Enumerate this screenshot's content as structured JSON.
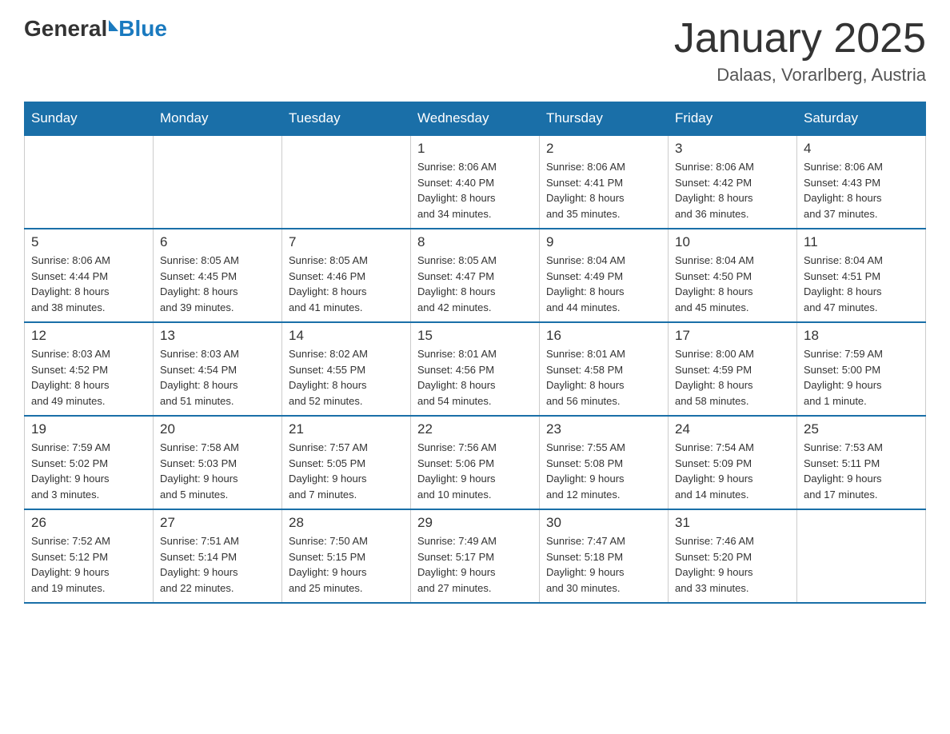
{
  "logo": {
    "general": "General",
    "blue": "Blue"
  },
  "title": "January 2025",
  "location": "Dalaas, Vorarlberg, Austria",
  "days_of_week": [
    "Sunday",
    "Monday",
    "Tuesday",
    "Wednesday",
    "Thursday",
    "Friday",
    "Saturday"
  ],
  "weeks": [
    {
      "days": [
        {
          "number": "",
          "info": ""
        },
        {
          "number": "",
          "info": ""
        },
        {
          "number": "",
          "info": ""
        },
        {
          "number": "1",
          "info": "Sunrise: 8:06 AM\nSunset: 4:40 PM\nDaylight: 8 hours\nand 34 minutes."
        },
        {
          "number": "2",
          "info": "Sunrise: 8:06 AM\nSunset: 4:41 PM\nDaylight: 8 hours\nand 35 minutes."
        },
        {
          "number": "3",
          "info": "Sunrise: 8:06 AM\nSunset: 4:42 PM\nDaylight: 8 hours\nand 36 minutes."
        },
        {
          "number": "4",
          "info": "Sunrise: 8:06 AM\nSunset: 4:43 PM\nDaylight: 8 hours\nand 37 minutes."
        }
      ]
    },
    {
      "days": [
        {
          "number": "5",
          "info": "Sunrise: 8:06 AM\nSunset: 4:44 PM\nDaylight: 8 hours\nand 38 minutes."
        },
        {
          "number": "6",
          "info": "Sunrise: 8:05 AM\nSunset: 4:45 PM\nDaylight: 8 hours\nand 39 minutes."
        },
        {
          "number": "7",
          "info": "Sunrise: 8:05 AM\nSunset: 4:46 PM\nDaylight: 8 hours\nand 41 minutes."
        },
        {
          "number": "8",
          "info": "Sunrise: 8:05 AM\nSunset: 4:47 PM\nDaylight: 8 hours\nand 42 minutes."
        },
        {
          "number": "9",
          "info": "Sunrise: 8:04 AM\nSunset: 4:49 PM\nDaylight: 8 hours\nand 44 minutes."
        },
        {
          "number": "10",
          "info": "Sunrise: 8:04 AM\nSunset: 4:50 PM\nDaylight: 8 hours\nand 45 minutes."
        },
        {
          "number": "11",
          "info": "Sunrise: 8:04 AM\nSunset: 4:51 PM\nDaylight: 8 hours\nand 47 minutes."
        }
      ]
    },
    {
      "days": [
        {
          "number": "12",
          "info": "Sunrise: 8:03 AM\nSunset: 4:52 PM\nDaylight: 8 hours\nand 49 minutes."
        },
        {
          "number": "13",
          "info": "Sunrise: 8:03 AM\nSunset: 4:54 PM\nDaylight: 8 hours\nand 51 minutes."
        },
        {
          "number": "14",
          "info": "Sunrise: 8:02 AM\nSunset: 4:55 PM\nDaylight: 8 hours\nand 52 minutes."
        },
        {
          "number": "15",
          "info": "Sunrise: 8:01 AM\nSunset: 4:56 PM\nDaylight: 8 hours\nand 54 minutes."
        },
        {
          "number": "16",
          "info": "Sunrise: 8:01 AM\nSunset: 4:58 PM\nDaylight: 8 hours\nand 56 minutes."
        },
        {
          "number": "17",
          "info": "Sunrise: 8:00 AM\nSunset: 4:59 PM\nDaylight: 8 hours\nand 58 minutes."
        },
        {
          "number": "18",
          "info": "Sunrise: 7:59 AM\nSunset: 5:00 PM\nDaylight: 9 hours\nand 1 minute."
        }
      ]
    },
    {
      "days": [
        {
          "number": "19",
          "info": "Sunrise: 7:59 AM\nSunset: 5:02 PM\nDaylight: 9 hours\nand 3 minutes."
        },
        {
          "number": "20",
          "info": "Sunrise: 7:58 AM\nSunset: 5:03 PM\nDaylight: 9 hours\nand 5 minutes."
        },
        {
          "number": "21",
          "info": "Sunrise: 7:57 AM\nSunset: 5:05 PM\nDaylight: 9 hours\nand 7 minutes."
        },
        {
          "number": "22",
          "info": "Sunrise: 7:56 AM\nSunset: 5:06 PM\nDaylight: 9 hours\nand 10 minutes."
        },
        {
          "number": "23",
          "info": "Sunrise: 7:55 AM\nSunset: 5:08 PM\nDaylight: 9 hours\nand 12 minutes."
        },
        {
          "number": "24",
          "info": "Sunrise: 7:54 AM\nSunset: 5:09 PM\nDaylight: 9 hours\nand 14 minutes."
        },
        {
          "number": "25",
          "info": "Sunrise: 7:53 AM\nSunset: 5:11 PM\nDaylight: 9 hours\nand 17 minutes."
        }
      ]
    },
    {
      "days": [
        {
          "number": "26",
          "info": "Sunrise: 7:52 AM\nSunset: 5:12 PM\nDaylight: 9 hours\nand 19 minutes."
        },
        {
          "number": "27",
          "info": "Sunrise: 7:51 AM\nSunset: 5:14 PM\nDaylight: 9 hours\nand 22 minutes."
        },
        {
          "number": "28",
          "info": "Sunrise: 7:50 AM\nSunset: 5:15 PM\nDaylight: 9 hours\nand 25 minutes."
        },
        {
          "number": "29",
          "info": "Sunrise: 7:49 AM\nSunset: 5:17 PM\nDaylight: 9 hours\nand 27 minutes."
        },
        {
          "number": "30",
          "info": "Sunrise: 7:47 AM\nSunset: 5:18 PM\nDaylight: 9 hours\nand 30 minutes."
        },
        {
          "number": "31",
          "info": "Sunrise: 7:46 AM\nSunset: 5:20 PM\nDaylight: 9 hours\nand 33 minutes."
        },
        {
          "number": "",
          "info": ""
        }
      ]
    }
  ]
}
